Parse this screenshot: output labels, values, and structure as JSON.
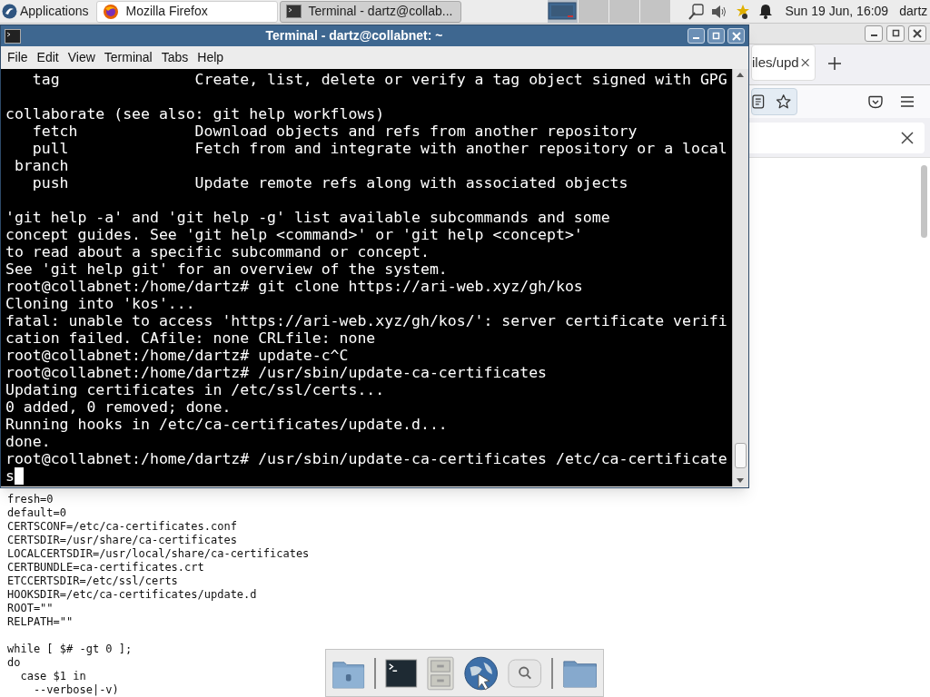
{
  "panel": {
    "menu": "Applications",
    "tasks": [
      {
        "kind": "browser",
        "label": "Mozilla Firefox",
        "selected": false
      },
      {
        "kind": "terminal",
        "label": "Terminal - dartz@collab...",
        "selected": true
      }
    ],
    "workspaces": [
      {
        "selected": true
      },
      {
        "selected": false
      },
      {
        "selected": false
      },
      {
        "selected": false
      }
    ],
    "clock": "Sun 19 Jun, 16:09",
    "user": "dartz"
  },
  "browser": {
    "tab_title": "iles/upd",
    "content_blocks": [
      [
        "fresh=0",
        "default=0",
        "CERTSCONF=/etc/ca-certificates.conf",
        "CERTSDIR=/usr/share/ca-certificates",
        "LOCALCERTSDIR=/usr/local/share/ca-certificates",
        "CERTBUNDLE=ca-certificates.crt",
        "ETCCERTSDIR=/etc/ssl/certs",
        "HOOKSDIR=/etc/ca-certificates/update.d",
        "ROOT=\"\"",
        "RELPATH=\"\""
      ],
      [
        "while [ $# -gt 0 ];",
        "do",
        "  case $1 in",
        "    --verbose|-v)"
      ]
    ]
  },
  "terminal": {
    "title": "Terminal - dartz@collabnet: ~",
    "menu": [
      "File",
      "Edit",
      "View",
      "Terminal",
      "Tabs",
      "Help"
    ],
    "blocks": [
      [
        "   tag               Create, list, delete or verify a tag object signed with GPG"
      ],
      [
        "collaborate (see also: git help workflows)",
        "   fetch             Download objects and refs from another repository",
        "   pull              Fetch from and integrate with another repository or a local",
        " branch",
        "   push              Update remote refs along with associated objects"
      ],
      [
        "'git help -a' and 'git help -g' list available subcommands and some",
        "concept guides. See 'git help <command>' or 'git help <concept>'",
        "to read about a specific subcommand or concept.",
        "See 'git help git' for an overview of the system.",
        "root@collabnet:/home/dartz# git clone https://ari-web.xyz/gh/kos",
        "Cloning into 'kos'...",
        "fatal: unable to access 'https://ari-web.xyz/gh/kos/': server certificate verifi",
        "cation failed. CAfile: none CRLfile: none",
        "root@collabnet:/home/dartz# update-c^C",
        "root@collabnet:/home/dartz# /usr/sbin/update-ca-certificates",
        "Updating certificates in /etc/ssl/certs...",
        "0 added, 0 removed; done.",
        "Running hooks in /etc/ca-certificates/update.d...",
        "done.",
        "root@collabnet:/home/dartz# /usr/sbin/update-ca-certificates /etc/ca-certificate",
        "s"
      ]
    ]
  }
}
